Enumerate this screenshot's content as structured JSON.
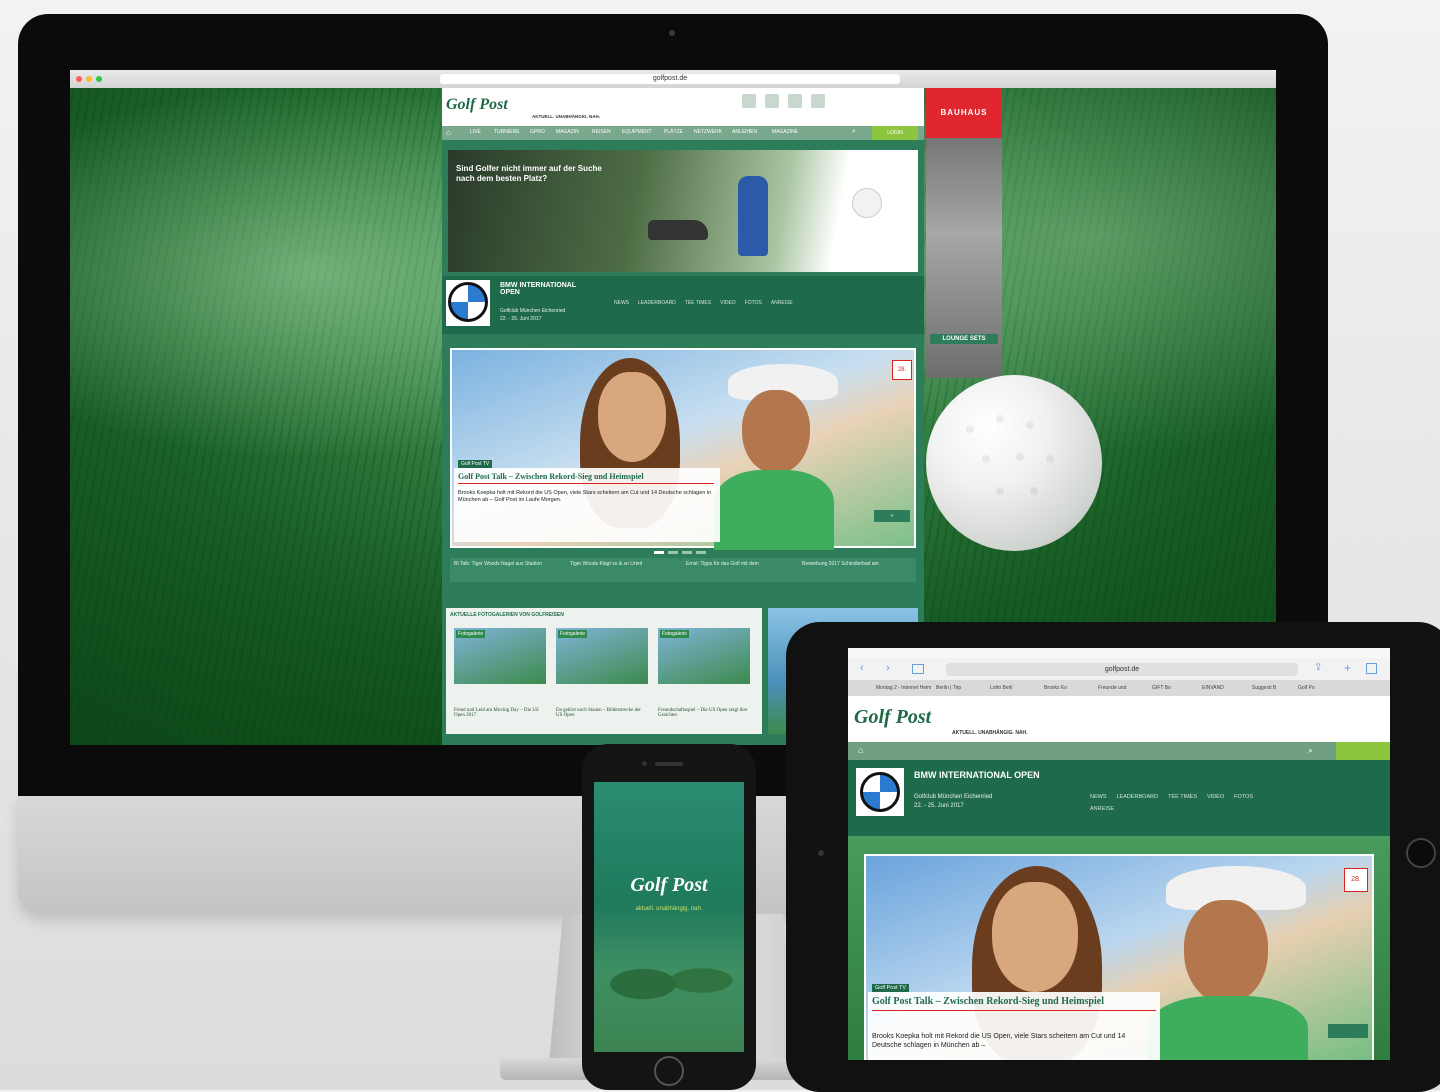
{
  "imac": {
    "browser_url": "golfpost.de",
    "site": {
      "logo": "Golf Post",
      "tagline": "AKTUELL. UNABHÄNGIG. NAH.",
      "nav_items": [
        "LIVE",
        "TURNIERE",
        "GPRO",
        "MAGAZIN",
        "REISEN",
        "EQUIPMENT",
        "PLÄTZE",
        "NETZWERK",
        "ANLEIHEN",
        "MAGAZINE"
      ],
      "login_label": "LOGIN",
      "ad_headline": "Sind Golfer nicht immer auf der Suche nach dem besten Platz?",
      "event": {
        "title": "BMW INTERNATIONAL OPEN",
        "location": "Golfclub München Eichenried",
        "dates": "22. - 25. Juni 2017",
        "links": [
          "NEWS",
          "LEADERBOARD",
          "TEE TIMES",
          "VIDEO",
          "FOTOS",
          "ANREISE"
        ]
      },
      "hero": {
        "badge": "Golf Post TV",
        "title": "Golf Post Talk – Zwischen Rekord-Sieg und Heimspiel",
        "text": "Brooks Koepka holt mit Rekord die US Open, viele Stars scheitern am Cut und 14 Deutsche schlagen in München ab – Golf Post im Laufe Morgen."
      },
      "news_strip": [
        "BI Talk: Tiger Woods Nagel aus Stadion",
        "Tiger Woods Klagt so & so Urteil",
        "Ernst: Tipps für das Golf mit dem",
        "Bewerbung 2017 Schindlerbad am"
      ],
      "gallery": {
        "title": "AKTUELLE FOTOGALERIEN VON GOLFREISEN",
        "items": [
          {
            "label": "Fotogalerie",
            "caption": "Freud und Leid am Moving Day – Die US Open 2017"
          },
          {
            "label": "Fotogalerie",
            "caption": "Da gehört noch Stauen – Bilderstrecke der US Open"
          },
          {
            "label": "Fotogalerie",
            "caption": "Freundschaftsspiel – Die US Open zeigt ihre Gesichter"
          }
        ]
      }
    },
    "right_ad": {
      "brand": "BAUHAUS",
      "product": "LOUNGE SETS"
    }
  },
  "ipad": {
    "url": "golfpost.de",
    "logo": "Golf Post",
    "tagline": "AKTUELL. UNABHÄNGIG. NAH.",
    "tabs": [
      "Montag 2 - Internet Heim",
      "Berlin | Trip",
      "Lotto Berli",
      "Brooks Ko",
      "Freunde und",
      "GIFT Bo",
      "EINVAND",
      "Suggesti B",
      "Golf Po"
    ],
    "event": {
      "title": "BMW INTERNATIONAL OPEN",
      "location": "Golfclub München Eichenried",
      "dates": "22. - 25. Juni 2017",
      "links": [
        "NEWS",
        "LEADERBOARD",
        "TEE TIMES",
        "VIDEO",
        "FOTOS",
        "ANREISE"
      ]
    },
    "hero": {
      "badge": "Golf Post TV",
      "title": "Golf Post Talk – Zwischen Rekord-Sieg und Heimspiel",
      "text": "Brooks Koepka holt mit Rekord die US Open, viele Stars scheitern am Cut und 14 Deutsche schlagen in München ab –",
      "date_badge": "28."
    }
  },
  "iphone": {
    "logo": "Golf Post",
    "tagline": "aktuell. unabhängig. nah."
  }
}
